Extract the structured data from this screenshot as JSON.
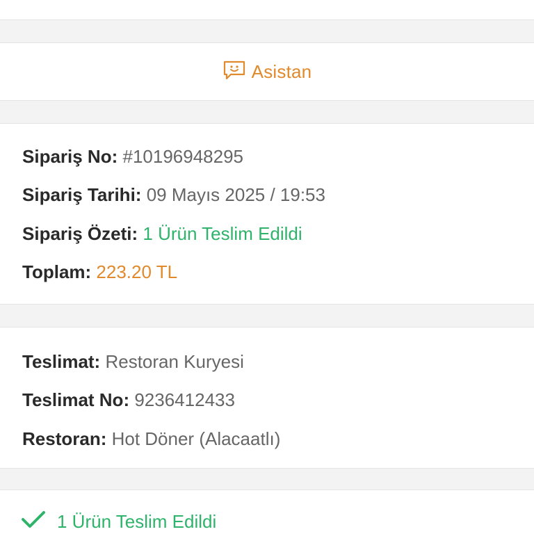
{
  "assistant": {
    "label": "Asistan",
    "icon": "chat-smile-icon"
  },
  "order": {
    "number_label": "Sipariş No:",
    "number_value": "#10196948295",
    "date_label": "Sipariş Tarihi:",
    "date_value": "09 Mayıs 2025 / 19:53",
    "summary_label": "Sipariş Özeti:",
    "summary_value": "1 Ürün Teslim Edildi",
    "total_label": "Toplam:",
    "total_value": "223.20 TL"
  },
  "delivery": {
    "type_label": "Teslimat:",
    "type_value": "Restoran Kuryesi",
    "number_label": "Teslimat No:",
    "number_value": "9236412433",
    "restaurant_label": "Restoran:",
    "restaurant_value": "Hot Döner (Alacaatlı)"
  },
  "status": {
    "text": "1 Ürün Teslim Edildi",
    "icon": "check-icon"
  },
  "colors": {
    "accent_orange": "#e08a2c",
    "success_green": "#2fb36b",
    "separator_gray": "#f3f3f3"
  }
}
